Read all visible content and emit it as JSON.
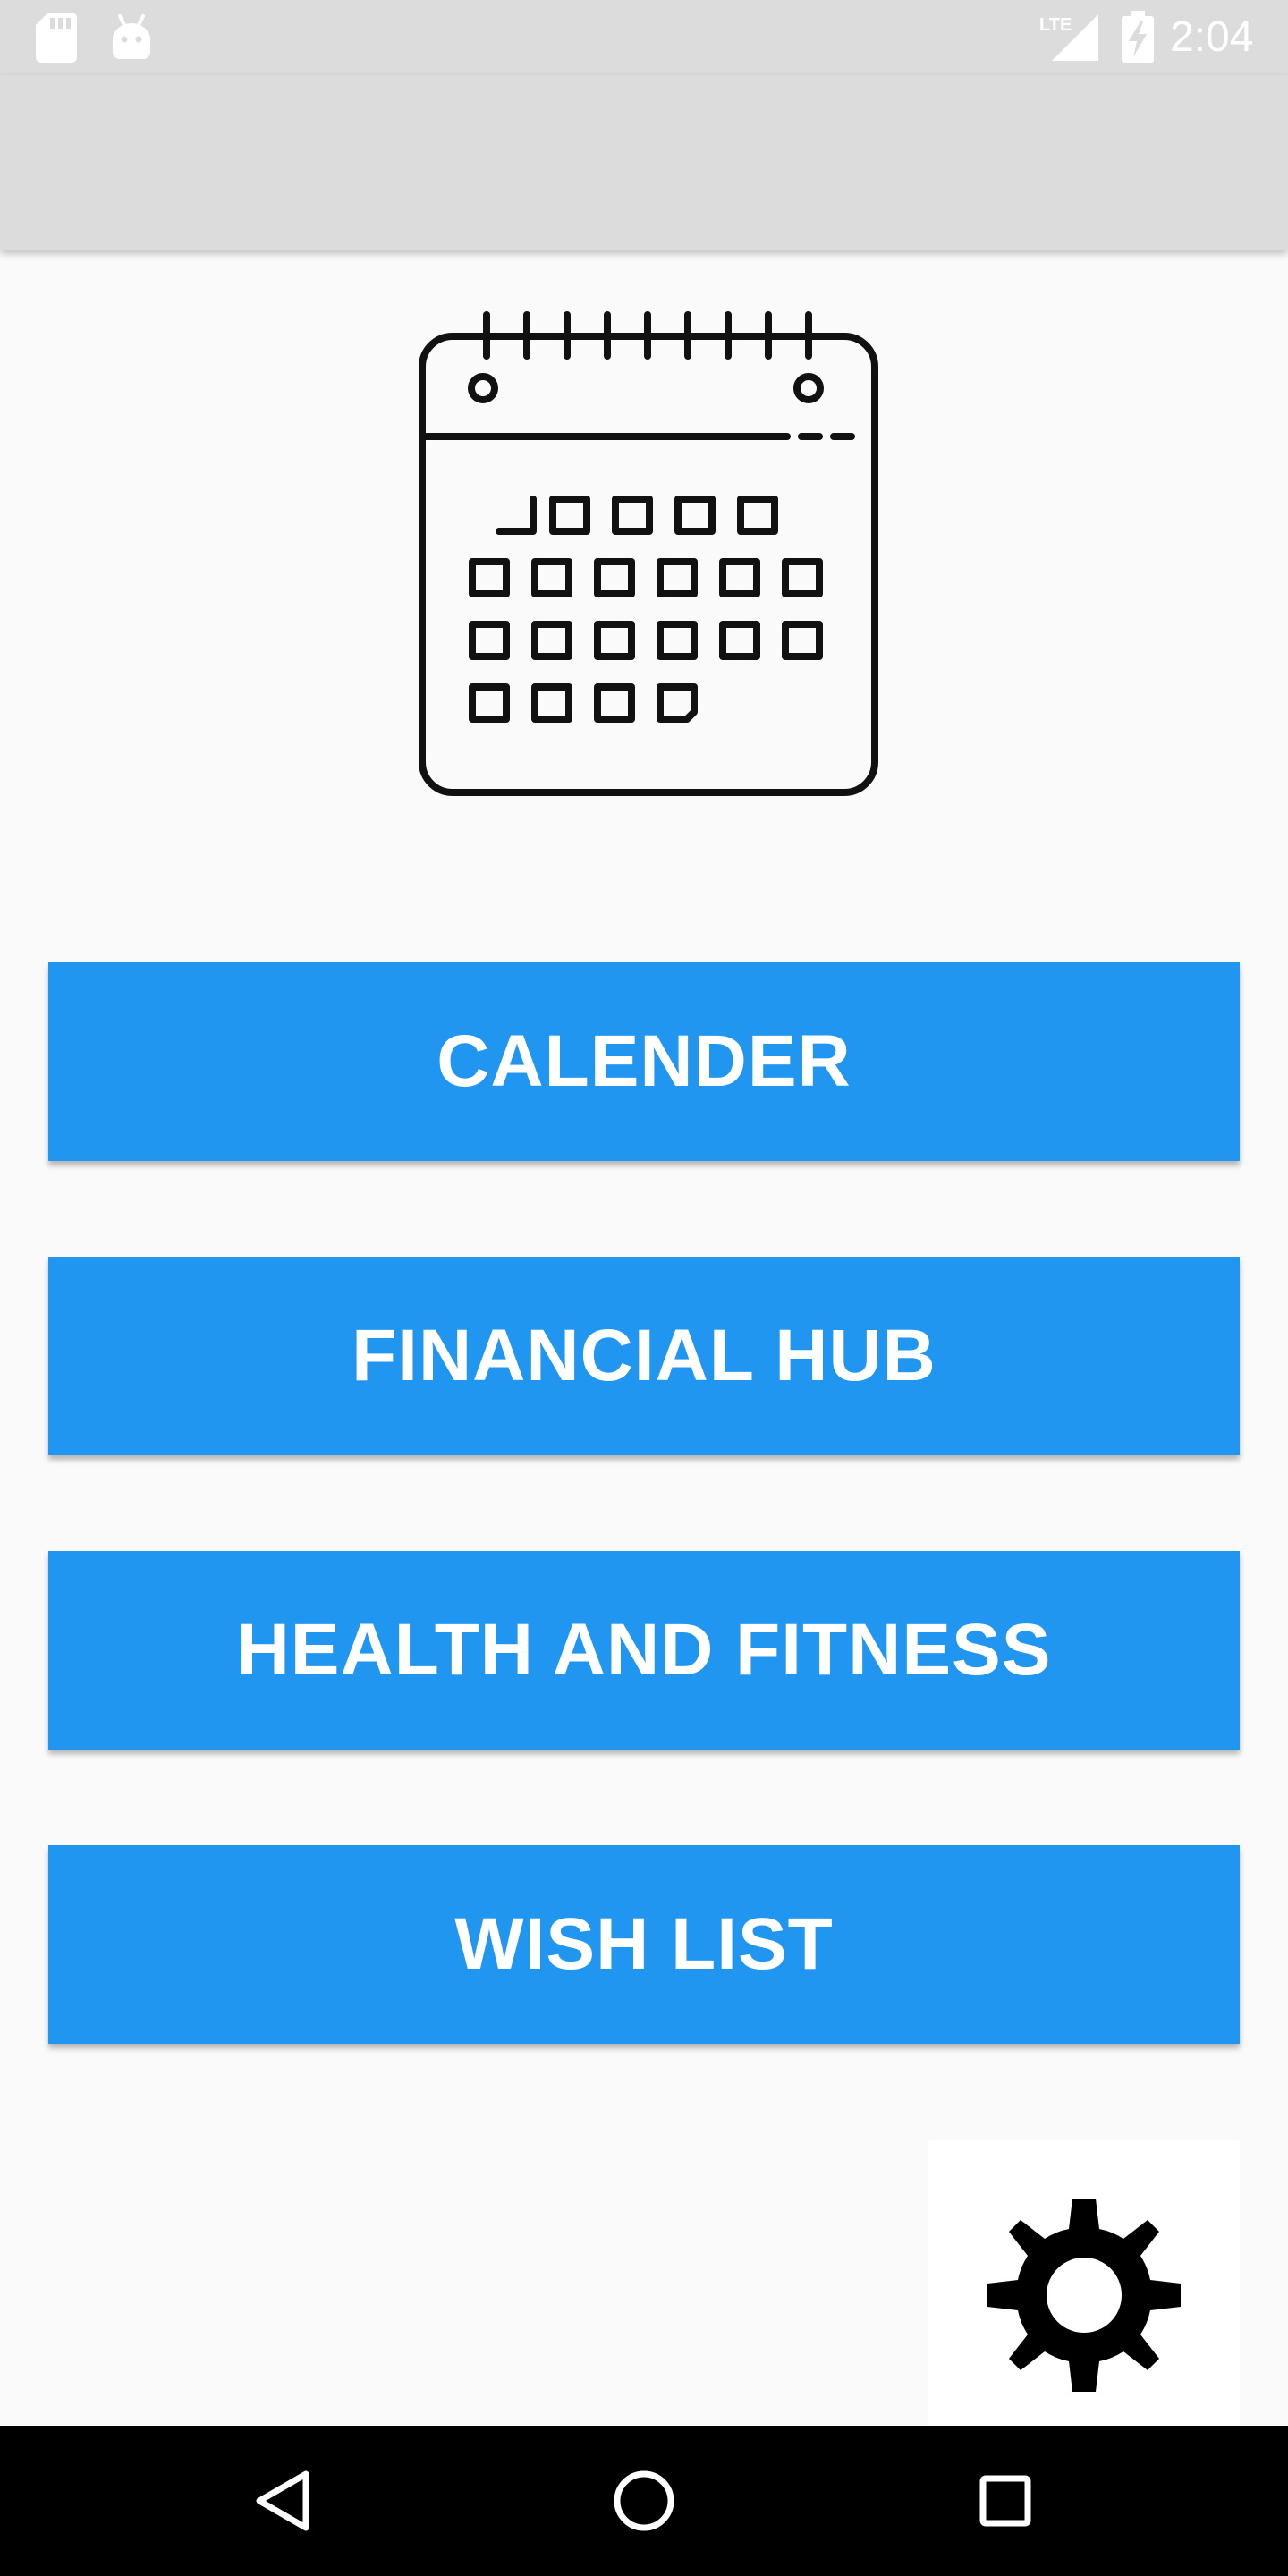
{
  "status_bar": {
    "time": "2:04",
    "network": "LTE",
    "icons": [
      "sd-card-icon",
      "android-icon",
      "lte-signal-icon",
      "battery-charging-icon"
    ],
    "background": "#dcdcdc"
  },
  "toolbar": {
    "background": "#dcdcdc"
  },
  "hero": {
    "icon": "calendar-icon"
  },
  "menu": {
    "accent": "#2196f0",
    "items": [
      {
        "label": "CALENDER"
      },
      {
        "label": "FINANCIAL HUB"
      },
      {
        "label": "HEALTH AND FITNESS"
      },
      {
        "label": "WISH LIST"
      }
    ]
  },
  "settings": {
    "icon": "gear-icon"
  },
  "navigation": {
    "buttons": [
      "back-icon",
      "home-icon",
      "recents-icon"
    ]
  }
}
